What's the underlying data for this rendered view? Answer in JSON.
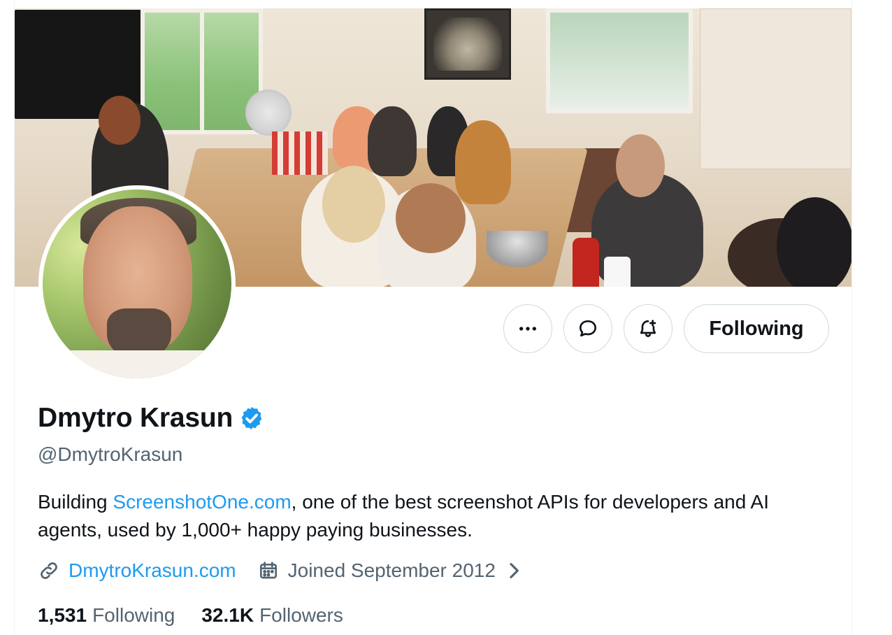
{
  "profile": {
    "display_name": "Dmytro Krasun",
    "handle": "@DmytroKrasun",
    "bio_prefix": "Building ",
    "bio_link_text": "ScreenshotOne.com",
    "bio_suffix": ", one of the best screenshot APIs for developers and AI agents, used by 1,000+ happy paying businesses.",
    "website": "DmytroKrasun.com",
    "joined": "Joined September 2012",
    "following_count": "1,531",
    "following_label": "Following",
    "followers_count": "32.1K",
    "followers_label": "Followers"
  },
  "actions": {
    "more_icon": "more-horizontal-icon",
    "message_icon": "message-bubble-icon",
    "notify_icon": "bell-plus-icon",
    "follow_label": "Following"
  },
  "colors": {
    "accent": "#1d9bf0",
    "text": "#0f1419",
    "secondary": "#536471",
    "border": "#cfd9de"
  },
  "icons": {
    "verified": "verified-badge-icon",
    "link": "link-icon",
    "calendar": "calendar-icon",
    "chevron": "chevron-right-icon"
  }
}
